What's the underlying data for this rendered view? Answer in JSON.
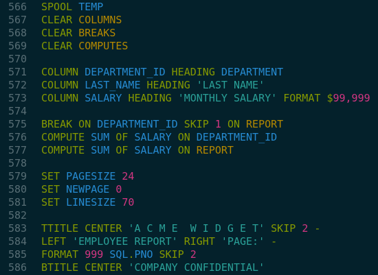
{
  "colors": {
    "background": "#04212b",
    "line_number": "#586e75",
    "keyword": "#859900",
    "identifier": "#268bd2",
    "constant": "#b58900",
    "string": "#2aa198",
    "number": "#d33682"
  },
  "lines": [
    {
      "num": "566",
      "tokens": [
        {
          "t": "SPOOL",
          "c": "kw"
        },
        {
          "t": " "
        },
        {
          "t": "TEMP",
          "c": "id"
        }
      ]
    },
    {
      "num": "567",
      "tokens": [
        {
          "t": "CLEAR",
          "c": "kw"
        },
        {
          "t": " "
        },
        {
          "t": "COLUMNS",
          "c": "con"
        }
      ]
    },
    {
      "num": "568",
      "tokens": [
        {
          "t": "CLEAR",
          "c": "kw"
        },
        {
          "t": " "
        },
        {
          "t": "BREAKS",
          "c": "con"
        }
      ]
    },
    {
      "num": "569",
      "tokens": [
        {
          "t": "CLEAR",
          "c": "kw"
        },
        {
          "t": " "
        },
        {
          "t": "COMPUTES",
          "c": "con"
        }
      ]
    },
    {
      "num": "570",
      "tokens": []
    },
    {
      "num": "571",
      "tokens": [
        {
          "t": "COLUMN",
          "c": "kw"
        },
        {
          "t": " "
        },
        {
          "t": "DEPARTMENT_ID",
          "c": "id"
        },
        {
          "t": " "
        },
        {
          "t": "HEADING",
          "c": "kw"
        },
        {
          "t": " "
        },
        {
          "t": "DEPARTMENT",
          "c": "id"
        }
      ]
    },
    {
      "num": "572",
      "tokens": [
        {
          "t": "COLUMN",
          "c": "kw"
        },
        {
          "t": " "
        },
        {
          "t": "LAST_NAME",
          "c": "id"
        },
        {
          "t": " "
        },
        {
          "t": "HEADING",
          "c": "kw"
        },
        {
          "t": " "
        },
        {
          "t": "'LAST NAME'",
          "c": "str"
        }
      ]
    },
    {
      "num": "573",
      "tokens": [
        {
          "t": "COLUMN",
          "c": "kw"
        },
        {
          "t": " "
        },
        {
          "t": "SALARY",
          "c": "id"
        },
        {
          "t": " "
        },
        {
          "t": "HEADING",
          "c": "kw"
        },
        {
          "t": " "
        },
        {
          "t": "'MONTHLY SALARY'",
          "c": "str"
        },
        {
          "t": " "
        },
        {
          "t": "FORMAT",
          "c": "kw"
        },
        {
          "t": " "
        },
        {
          "t": "$",
          "c": "p"
        },
        {
          "t": "99,999",
          "c": "n"
        }
      ]
    },
    {
      "num": "574",
      "tokens": []
    },
    {
      "num": "575",
      "tokens": [
        {
          "t": "BREAK ON",
          "c": "kw"
        },
        {
          "t": " "
        },
        {
          "t": "DEPARTMENT_ID",
          "c": "id"
        },
        {
          "t": " "
        },
        {
          "t": "SKIP",
          "c": "kw"
        },
        {
          "t": " "
        },
        {
          "t": "1",
          "c": "n"
        },
        {
          "t": " "
        },
        {
          "t": "ON",
          "c": "kw"
        },
        {
          "t": " "
        },
        {
          "t": "REPORT",
          "c": "con"
        }
      ]
    },
    {
      "num": "576",
      "tokens": [
        {
          "t": "COMPUTE",
          "c": "kw"
        },
        {
          "t": " "
        },
        {
          "t": "SUM",
          "c": "id"
        },
        {
          "t": " "
        },
        {
          "t": "OF",
          "c": "kw"
        },
        {
          "t": " "
        },
        {
          "t": "SALARY",
          "c": "id"
        },
        {
          "t": " "
        },
        {
          "t": "ON",
          "c": "kw"
        },
        {
          "t": " "
        },
        {
          "t": "DEPARTMENT_ID",
          "c": "id"
        }
      ]
    },
    {
      "num": "577",
      "tokens": [
        {
          "t": "COMPUTE",
          "c": "kw"
        },
        {
          "t": " "
        },
        {
          "t": "SUM",
          "c": "id"
        },
        {
          "t": " "
        },
        {
          "t": "OF",
          "c": "kw"
        },
        {
          "t": " "
        },
        {
          "t": "SALARY",
          "c": "id"
        },
        {
          "t": " "
        },
        {
          "t": "ON",
          "c": "kw"
        },
        {
          "t": " "
        },
        {
          "t": "REPORT",
          "c": "con"
        }
      ]
    },
    {
      "num": "578",
      "tokens": []
    },
    {
      "num": "579",
      "tokens": [
        {
          "t": "SET",
          "c": "kw"
        },
        {
          "t": " "
        },
        {
          "t": "PAGESIZE",
          "c": "id"
        },
        {
          "t": " "
        },
        {
          "t": "24",
          "c": "n"
        }
      ]
    },
    {
      "num": "580",
      "tokens": [
        {
          "t": "SET",
          "c": "kw"
        },
        {
          "t": " "
        },
        {
          "t": "NEWPAGE",
          "c": "id"
        },
        {
          "t": " "
        },
        {
          "t": "0",
          "c": "n"
        }
      ]
    },
    {
      "num": "581",
      "tokens": [
        {
          "t": "SET",
          "c": "kw"
        },
        {
          "t": " "
        },
        {
          "t": "LINESIZE",
          "c": "id"
        },
        {
          "t": " "
        },
        {
          "t": "70",
          "c": "n"
        }
      ]
    },
    {
      "num": "582",
      "tokens": []
    },
    {
      "num": "583",
      "tokens": [
        {
          "t": "TTITLE CENTER",
          "c": "kw"
        },
        {
          "t": " "
        },
        {
          "t": "'A C M E  W I D G E T'",
          "c": "str"
        },
        {
          "t": " "
        },
        {
          "t": "SKIP",
          "c": "kw"
        },
        {
          "t": " "
        },
        {
          "t": "2",
          "c": "n"
        },
        {
          "t": " "
        },
        {
          "t": "-",
          "c": "p"
        }
      ]
    },
    {
      "num": "584",
      "tokens": [
        {
          "t": "LEFT",
          "c": "kw"
        },
        {
          "t": " "
        },
        {
          "t": "'EMPLOYEE REPORT'",
          "c": "str"
        },
        {
          "t": " "
        },
        {
          "t": "RIGHT",
          "c": "kw"
        },
        {
          "t": " "
        },
        {
          "t": "'PAGE:'",
          "c": "str"
        },
        {
          "t": " "
        },
        {
          "t": "-",
          "c": "p"
        }
      ]
    },
    {
      "num": "585",
      "tokens": [
        {
          "t": "FORMAT",
          "c": "kw"
        },
        {
          "t": " "
        },
        {
          "t": "999",
          "c": "n"
        },
        {
          "t": " "
        },
        {
          "t": "SQL",
          "c": "id"
        },
        {
          "t": ".",
          "c": "p"
        },
        {
          "t": "PNO",
          "c": "id"
        },
        {
          "t": " "
        },
        {
          "t": "SKIP",
          "c": "kw"
        },
        {
          "t": " "
        },
        {
          "t": "2",
          "c": "n"
        }
      ]
    },
    {
      "num": "586",
      "tokens": [
        {
          "t": "BTITLE CENTER",
          "c": "kw"
        },
        {
          "t": " "
        },
        {
          "t": "'COMPANY CONFIDENTIAL'",
          "c": "str"
        }
      ]
    }
  ]
}
